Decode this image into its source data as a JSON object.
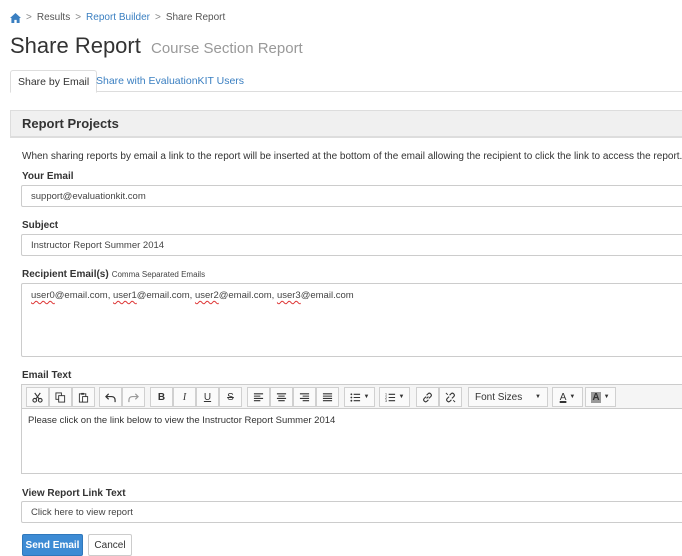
{
  "breadcrumb": {
    "home_icon": "home-icon",
    "items": [
      "Results",
      "Report Builder",
      "Share Report"
    ]
  },
  "page": {
    "title": "Share Report",
    "subtitle": "Course Section Report"
  },
  "tabs": [
    {
      "label": "Share by Email",
      "active": true
    },
    {
      "label": "Share with EvaluationKIT Users",
      "active": false
    }
  ],
  "panel": {
    "heading": "Report Projects",
    "intro": "When sharing reports by email a link to the report will be inserted at the bottom of the email allowing the recipient to click the link to access the report."
  },
  "form": {
    "your_email_label": "Your Email",
    "your_email_value": "support@evaluationkit.com",
    "subject_label": "Subject",
    "subject_value": "Instructor Report Summer 2014",
    "recipients_label": "Recipient Email(s)",
    "recipients_hint": "Comma Separated Emails",
    "recipients": [
      {
        "name": "user0",
        "domain": "@email.com, "
      },
      {
        "name": "user1",
        "domain": "@email.com, "
      },
      {
        "name": "user2",
        "domain": "@email.com, "
      },
      {
        "name": "user3",
        "domain": "@email.com"
      }
    ],
    "email_text_label": "Email Text",
    "email_text_value": "Please click on the link below to view the Instructor Report Summer 2014",
    "link_text_label": "View Report Link Text",
    "link_text_value": "Click here to view report"
  },
  "editor_toolbar": {
    "icons": [
      "cut-icon",
      "copy-icon",
      "paste-icon",
      "undo-icon",
      "redo-icon",
      "bold-icon",
      "italic-icon",
      "underline-icon",
      "strikethrough-icon",
      "align-left-icon",
      "align-center-icon",
      "align-right-icon",
      "align-justify-icon",
      "bullet-list-icon",
      "numbered-list-icon",
      "link-icon",
      "unlink-icon",
      "text-color-icon",
      "highlight-color-icon"
    ],
    "font_sizes_label": "Font Sizes",
    "bold_glyph": "B",
    "italic_glyph": "I",
    "underline_glyph": "U",
    "strike_glyph": "S",
    "font_color_glyph": "A",
    "bg_color_glyph": "A"
  },
  "actions": {
    "send_label": "Send Email",
    "cancel_label": "Cancel"
  },
  "colors": {
    "link": "#3a7fc1",
    "primary_button": "#3d8bd4",
    "panel_header_bg": "#f0f0f0"
  }
}
